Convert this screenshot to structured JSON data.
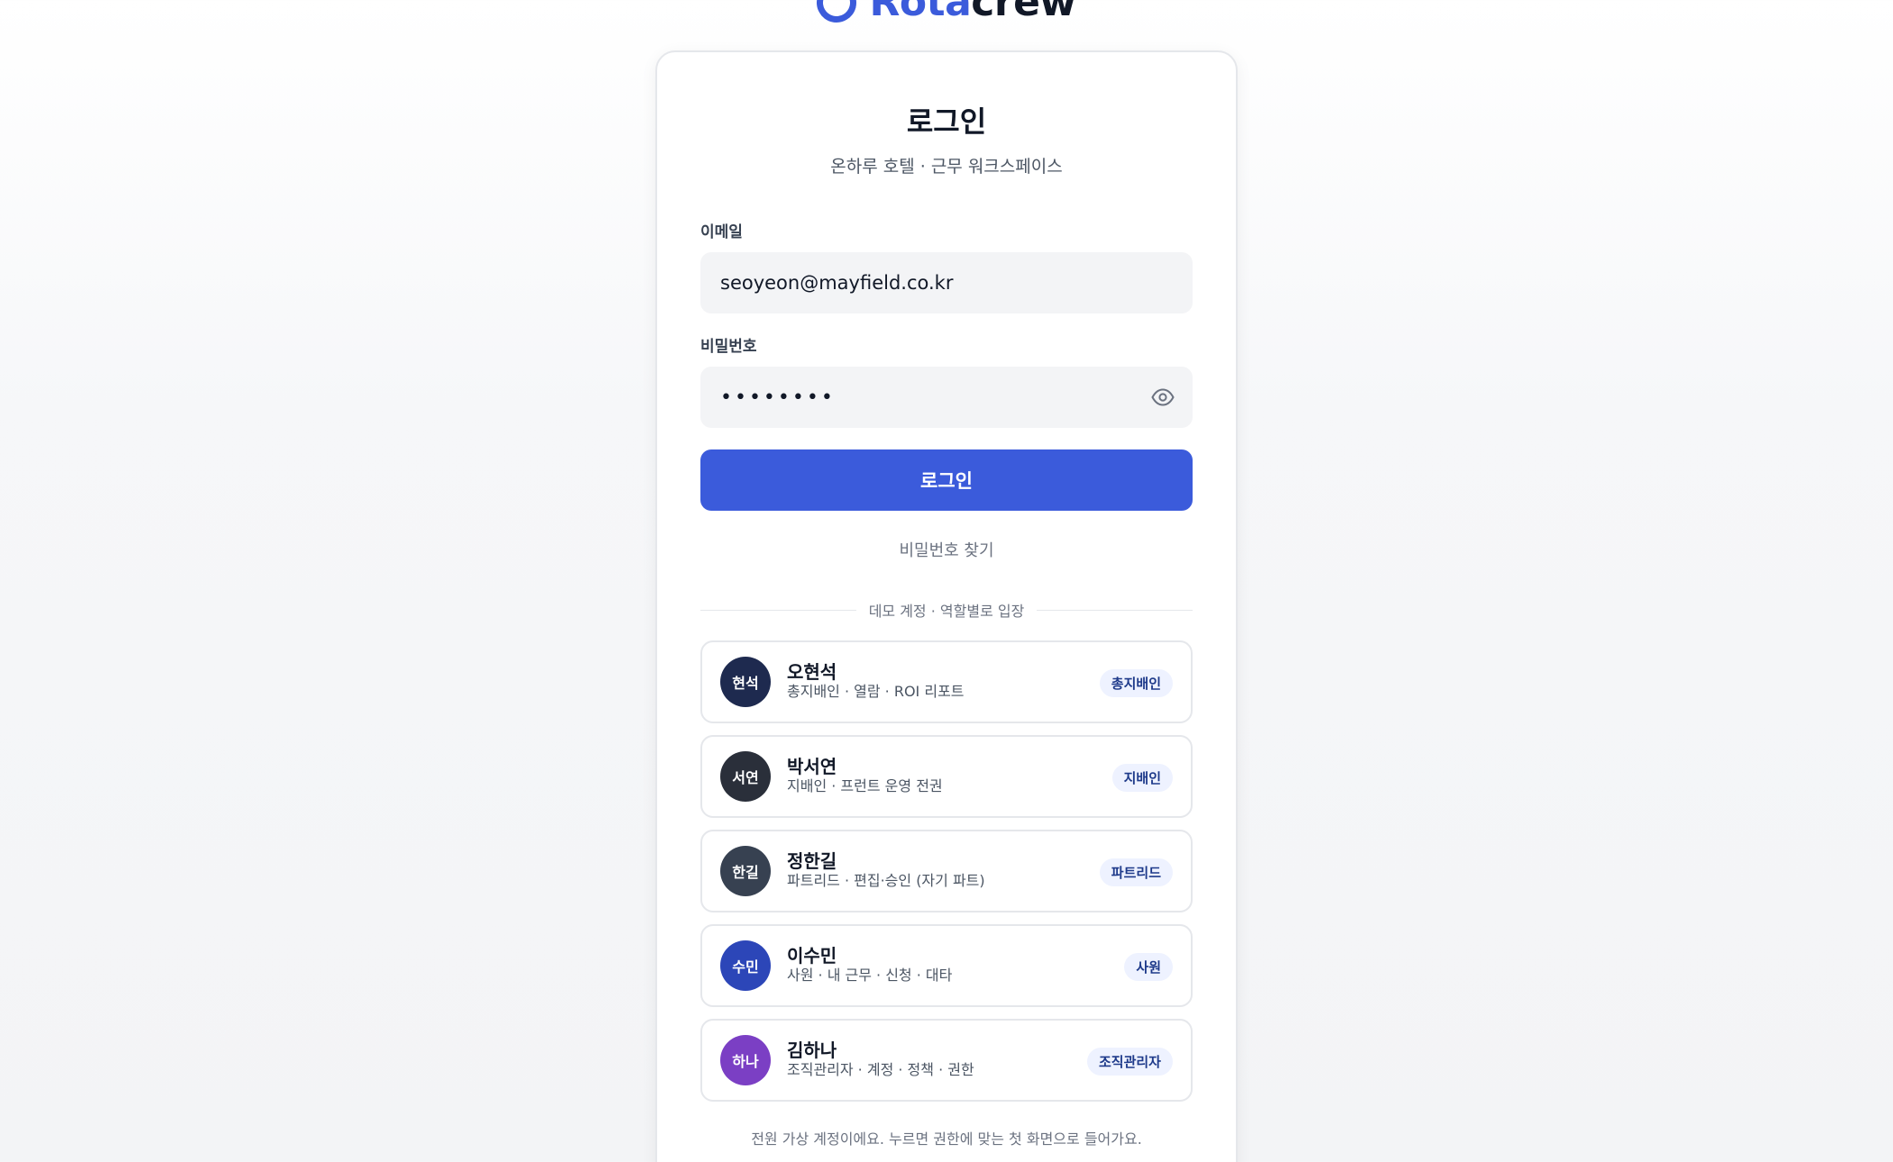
{
  "brand": {
    "name_accent": "Rota",
    "name_rest": "crew",
    "accent_color": "#3b5bdb"
  },
  "login": {
    "title": "로그인",
    "subtitle": "온하루 호텔 · 근무 워크스페이스",
    "email_label": "이메일",
    "email_value": "seoyeon@mayfield.co.kr",
    "password_label": "비밀번호",
    "password_value": "••••••••",
    "password_toggle_icon": "eye-icon",
    "submit_label": "로그인",
    "find_password_label": "비밀번호 찾기"
  },
  "demo": {
    "divider_label": "데모 계정 · 역할별로 입장",
    "accounts": [
      {
        "initials": "현석",
        "name": "오현석",
        "desc": "총지배인 · 열람 · ROI 리포트",
        "role": "총지배인",
        "avatar_color": "#1e2a4f"
      },
      {
        "initials": "서연",
        "name": "박서연",
        "desc": "지배인 · 프런트 운영 전권",
        "role": "지배인",
        "avatar_color": "#2a2f3a"
      },
      {
        "initials": "한길",
        "name": "정한길",
        "desc": "파트리드 · 편집·승인 (자기 파트)",
        "role": "파트리드",
        "avatar_color": "#374151"
      },
      {
        "initials": "수민",
        "name": "이수민",
        "desc": "사원 · 내 근무 · 신청 · 대타",
        "role": "사원",
        "avatar_color": "#2c46b8"
      },
      {
        "initials": "하나",
        "name": "김하나",
        "desc": "조직관리자 · 계정 · 정책 · 권한",
        "role": "조직관리자",
        "avatar_color": "#7b3fc4"
      }
    ],
    "footnote": "전원 가상 계정이에요. 누르면 권한에 맞는 첫 화면으로 들어가요."
  }
}
